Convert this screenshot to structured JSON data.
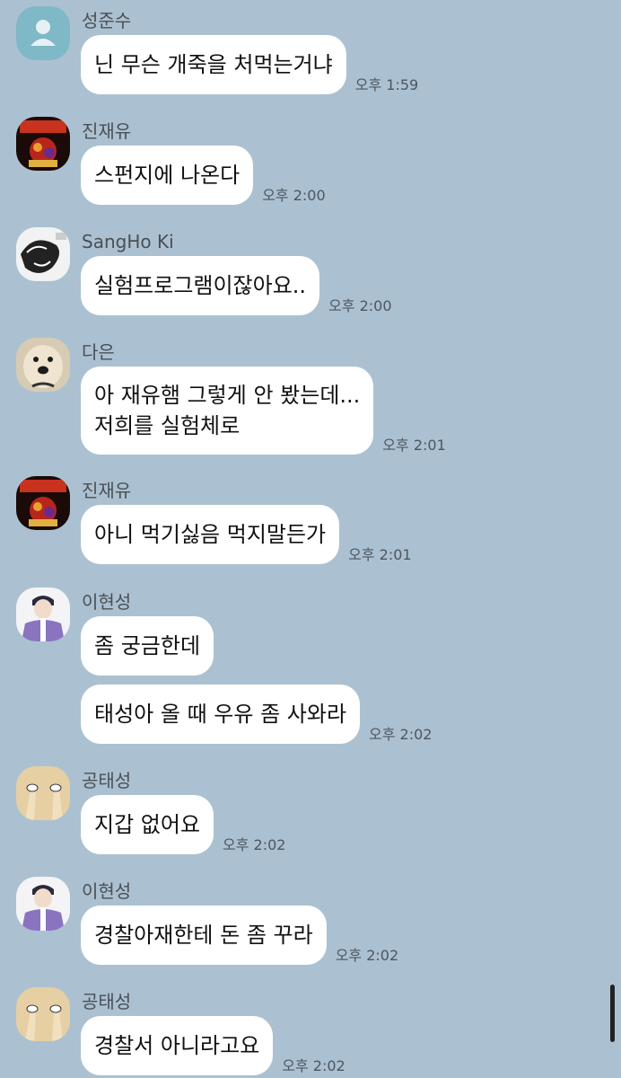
{
  "messages": [
    {
      "sender": "성준수",
      "avatar": "default-avatar",
      "bubbles": [
        {
          "lines": [
            "닌 무슨 개죽을 처먹는거냐"
          ]
        }
      ],
      "time": "오후 1:59"
    },
    {
      "sender": "진재유",
      "avatar": "acdc-avatar",
      "bubbles": [
        {
          "lines": [
            "스펀지에 나온다"
          ]
        }
      ],
      "time": "오후 2:00"
    },
    {
      "sender": "SangHo Ki",
      "avatar": "sketch-avatar",
      "bubbles": [
        {
          "lines": [
            "실험프로그램이잖아요.."
          ]
        }
      ],
      "time": "오후 2:00"
    },
    {
      "sender": "다은",
      "avatar": "dog-avatar",
      "bubbles": [
        {
          "lines": [
            "아 재유햄 그렇게 안 봤는데...",
            "저희를 실험체로"
          ]
        }
      ],
      "time": "오후 2:01"
    },
    {
      "sender": "진재유",
      "avatar": "acdc-avatar",
      "bubbles": [
        {
          "lines": [
            "아니 먹기싫음 먹지말든가"
          ]
        }
      ],
      "time": "오후 2:01"
    },
    {
      "sender": "이현성",
      "avatar": "anime-boy-avatar",
      "bubbles": [
        {
          "lines": [
            "좀 궁금한데"
          ]
        },
        {
          "lines": [
            "태성아 올 때 우유 좀 사와라"
          ]
        }
      ],
      "time": "오후 2:02"
    },
    {
      "sender": "공태성",
      "avatar": "shoes-avatar",
      "bubbles": [
        {
          "lines": [
            "지갑 없어요"
          ]
        }
      ],
      "time": "오후 2:02"
    },
    {
      "sender": "이현성",
      "avatar": "anime-boy-avatar",
      "bubbles": [
        {
          "lines": [
            "경찰아재한테 돈 좀 꾸라"
          ]
        }
      ],
      "time": "오후 2:02"
    },
    {
      "sender": "공태성",
      "avatar": "shoes-avatar",
      "bubbles": [
        {
          "lines": [
            "경찰서 아니라고요"
          ]
        }
      ],
      "time": "오후 2:02"
    }
  ]
}
